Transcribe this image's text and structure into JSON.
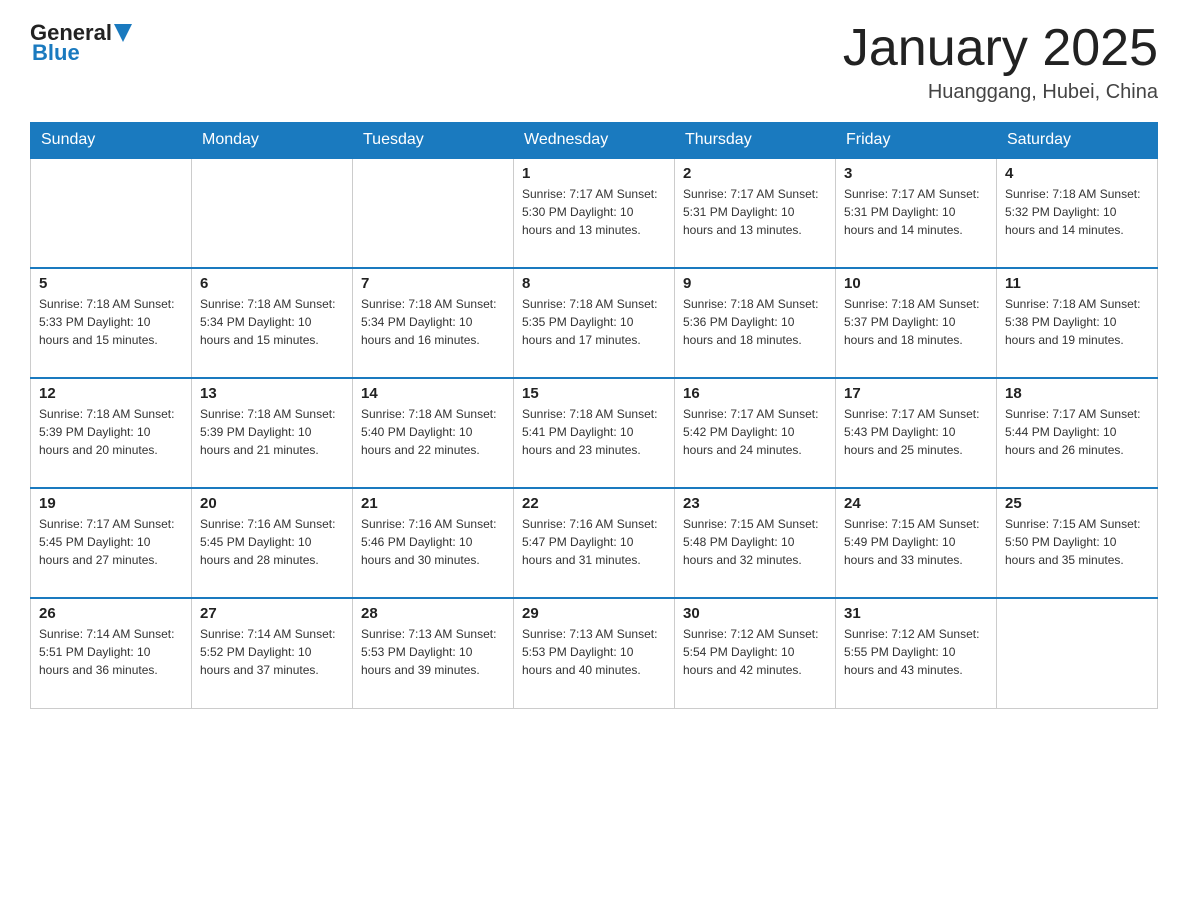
{
  "header": {
    "logo_general": "General",
    "logo_blue": "Blue",
    "month_title": "January 2025",
    "location": "Huanggang, Hubei, China"
  },
  "weekdays": [
    "Sunday",
    "Monday",
    "Tuesday",
    "Wednesday",
    "Thursday",
    "Friday",
    "Saturday"
  ],
  "weeks": [
    [
      {
        "day": "",
        "info": ""
      },
      {
        "day": "",
        "info": ""
      },
      {
        "day": "",
        "info": ""
      },
      {
        "day": "1",
        "info": "Sunrise: 7:17 AM\nSunset: 5:30 PM\nDaylight: 10 hours\nand 13 minutes."
      },
      {
        "day": "2",
        "info": "Sunrise: 7:17 AM\nSunset: 5:31 PM\nDaylight: 10 hours\nand 13 minutes."
      },
      {
        "day": "3",
        "info": "Sunrise: 7:17 AM\nSunset: 5:31 PM\nDaylight: 10 hours\nand 14 minutes."
      },
      {
        "day": "4",
        "info": "Sunrise: 7:18 AM\nSunset: 5:32 PM\nDaylight: 10 hours\nand 14 minutes."
      }
    ],
    [
      {
        "day": "5",
        "info": "Sunrise: 7:18 AM\nSunset: 5:33 PM\nDaylight: 10 hours\nand 15 minutes."
      },
      {
        "day": "6",
        "info": "Sunrise: 7:18 AM\nSunset: 5:34 PM\nDaylight: 10 hours\nand 15 minutes."
      },
      {
        "day": "7",
        "info": "Sunrise: 7:18 AM\nSunset: 5:34 PM\nDaylight: 10 hours\nand 16 minutes."
      },
      {
        "day": "8",
        "info": "Sunrise: 7:18 AM\nSunset: 5:35 PM\nDaylight: 10 hours\nand 17 minutes."
      },
      {
        "day": "9",
        "info": "Sunrise: 7:18 AM\nSunset: 5:36 PM\nDaylight: 10 hours\nand 18 minutes."
      },
      {
        "day": "10",
        "info": "Sunrise: 7:18 AM\nSunset: 5:37 PM\nDaylight: 10 hours\nand 18 minutes."
      },
      {
        "day": "11",
        "info": "Sunrise: 7:18 AM\nSunset: 5:38 PM\nDaylight: 10 hours\nand 19 minutes."
      }
    ],
    [
      {
        "day": "12",
        "info": "Sunrise: 7:18 AM\nSunset: 5:39 PM\nDaylight: 10 hours\nand 20 minutes."
      },
      {
        "day": "13",
        "info": "Sunrise: 7:18 AM\nSunset: 5:39 PM\nDaylight: 10 hours\nand 21 minutes."
      },
      {
        "day": "14",
        "info": "Sunrise: 7:18 AM\nSunset: 5:40 PM\nDaylight: 10 hours\nand 22 minutes."
      },
      {
        "day": "15",
        "info": "Sunrise: 7:18 AM\nSunset: 5:41 PM\nDaylight: 10 hours\nand 23 minutes."
      },
      {
        "day": "16",
        "info": "Sunrise: 7:17 AM\nSunset: 5:42 PM\nDaylight: 10 hours\nand 24 minutes."
      },
      {
        "day": "17",
        "info": "Sunrise: 7:17 AM\nSunset: 5:43 PM\nDaylight: 10 hours\nand 25 minutes."
      },
      {
        "day": "18",
        "info": "Sunrise: 7:17 AM\nSunset: 5:44 PM\nDaylight: 10 hours\nand 26 minutes."
      }
    ],
    [
      {
        "day": "19",
        "info": "Sunrise: 7:17 AM\nSunset: 5:45 PM\nDaylight: 10 hours\nand 27 minutes."
      },
      {
        "day": "20",
        "info": "Sunrise: 7:16 AM\nSunset: 5:45 PM\nDaylight: 10 hours\nand 28 minutes."
      },
      {
        "day": "21",
        "info": "Sunrise: 7:16 AM\nSunset: 5:46 PM\nDaylight: 10 hours\nand 30 minutes."
      },
      {
        "day": "22",
        "info": "Sunrise: 7:16 AM\nSunset: 5:47 PM\nDaylight: 10 hours\nand 31 minutes."
      },
      {
        "day": "23",
        "info": "Sunrise: 7:15 AM\nSunset: 5:48 PM\nDaylight: 10 hours\nand 32 minutes."
      },
      {
        "day": "24",
        "info": "Sunrise: 7:15 AM\nSunset: 5:49 PM\nDaylight: 10 hours\nand 33 minutes."
      },
      {
        "day": "25",
        "info": "Sunrise: 7:15 AM\nSunset: 5:50 PM\nDaylight: 10 hours\nand 35 minutes."
      }
    ],
    [
      {
        "day": "26",
        "info": "Sunrise: 7:14 AM\nSunset: 5:51 PM\nDaylight: 10 hours\nand 36 minutes."
      },
      {
        "day": "27",
        "info": "Sunrise: 7:14 AM\nSunset: 5:52 PM\nDaylight: 10 hours\nand 37 minutes."
      },
      {
        "day": "28",
        "info": "Sunrise: 7:13 AM\nSunset: 5:53 PM\nDaylight: 10 hours\nand 39 minutes."
      },
      {
        "day": "29",
        "info": "Sunrise: 7:13 AM\nSunset: 5:53 PM\nDaylight: 10 hours\nand 40 minutes."
      },
      {
        "day": "30",
        "info": "Sunrise: 7:12 AM\nSunset: 5:54 PM\nDaylight: 10 hours\nand 42 minutes."
      },
      {
        "day": "31",
        "info": "Sunrise: 7:12 AM\nSunset: 5:55 PM\nDaylight: 10 hours\nand 43 minutes."
      },
      {
        "day": "",
        "info": ""
      }
    ]
  ]
}
